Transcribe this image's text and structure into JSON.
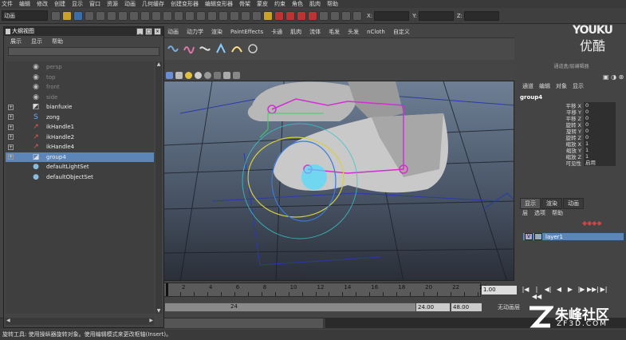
{
  "app": {
    "menus": [
      "文件",
      "编辑",
      "修改",
      "创建",
      "显示",
      "窗口",
      "资源",
      "动画",
      "几何缓存",
      "创建变形器",
      "编辑变形器",
      "骨架",
      "蒙皮",
      "约束",
      "角色",
      "肌肉",
      "帮助"
    ],
    "mode_selector": "动画",
    "xyz_labels": [
      "X:",
      "Y:",
      "Z:"
    ]
  },
  "shelf": {
    "tabs": [
      "动画",
      "动力学",
      "渲染",
      "PaintEffects",
      "卡通",
      "肌肉",
      "流体",
      "毛发",
      "头发",
      "nCloth",
      "自定义"
    ]
  },
  "outliner": {
    "title": "大纲视图",
    "menu": [
      "展示",
      "显示",
      "帮助"
    ],
    "items": [
      {
        "label": "persp",
        "icon": "camera-icon",
        "dim": true,
        "expandable": false,
        "selected": false
      },
      {
        "label": "top",
        "icon": "camera-icon",
        "dim": true,
        "expandable": false,
        "selected": false
      },
      {
        "label": "front",
        "icon": "camera-icon",
        "dim": true,
        "expandable": false,
        "selected": false
      },
      {
        "label": "side",
        "icon": "camera-icon",
        "dim": true,
        "expandable": false,
        "selected": false
      },
      {
        "label": "bianfuxie",
        "icon": "mesh-icon",
        "dim": false,
        "expandable": true,
        "selected": false
      },
      {
        "label": "zong",
        "icon": "curve-icon",
        "dim": false,
        "expandable": true,
        "selected": false
      },
      {
        "label": "ikHandle1",
        "icon": "ik-handle-icon",
        "dim": false,
        "expandable": true,
        "selected": false
      },
      {
        "label": "ikHandle2",
        "icon": "ik-handle-icon",
        "dim": false,
        "expandable": true,
        "selected": false
      },
      {
        "label": "ikHandle4",
        "icon": "ik-handle-icon",
        "dim": false,
        "expandable": true,
        "selected": false
      },
      {
        "label": "group4",
        "icon": "group-icon",
        "dim": false,
        "expandable": true,
        "selected": true
      },
      {
        "label": "defaultLightSet",
        "icon": "set-icon",
        "dim": false,
        "expandable": false,
        "selected": false
      },
      {
        "label": "defaultObjectSet",
        "icon": "set-icon",
        "dim": false,
        "expandable": false,
        "selected": false
      }
    ]
  },
  "channel_box": {
    "header": "通道盒/层编辑器",
    "menu": [
      "通道",
      "编辑",
      "对象",
      "显示"
    ],
    "node": "group4",
    "attributes": [
      {
        "name": "平移 X",
        "value": "0"
      },
      {
        "name": "平移 Y",
        "value": "0"
      },
      {
        "name": "平移 Z",
        "value": "0"
      },
      {
        "name": "旋转 X",
        "value": "0"
      },
      {
        "name": "旋转 Y",
        "value": "0"
      },
      {
        "name": "旋转 Z",
        "value": "0"
      },
      {
        "name": "缩放 X",
        "value": "1"
      },
      {
        "name": "缩放 Y",
        "value": "1"
      },
      {
        "name": "缩放 Z",
        "value": "1"
      },
      {
        "name": "可见性",
        "value": "启用"
      }
    ]
  },
  "layer_editor": {
    "tabs": [
      "显示",
      "渲染",
      "动画"
    ],
    "menu": [
      "层",
      "选项",
      "帮助"
    ],
    "layer": {
      "visible": "V",
      "name": "layer1"
    }
  },
  "timeline": {
    "ticks": [
      "2",
      "4",
      "6",
      "8",
      "10",
      "12",
      "14",
      "16",
      "18",
      "20",
      "22",
      "24"
    ],
    "current_frame": "1.00",
    "range_end_label": "24",
    "end_time": "24.00",
    "max_time": "48.00",
    "anim_layer": "无动画层",
    "play_controls": [
      "|◀",
      "|◀◀",
      "◀|",
      "◀",
      "▶",
      "|▶",
      "▶▶|",
      "▶|"
    ]
  },
  "help_line": "旋转工具: 使用操纵器旋转对象。使用编辑模式来更改枢轴(Insert)。",
  "watermarks": {
    "youku_latin": "YOUKU",
    "youku_cn": "优酷",
    "zf3d_cn": "朱峰社区",
    "zf3d_latin": "ZF3D.COM"
  }
}
